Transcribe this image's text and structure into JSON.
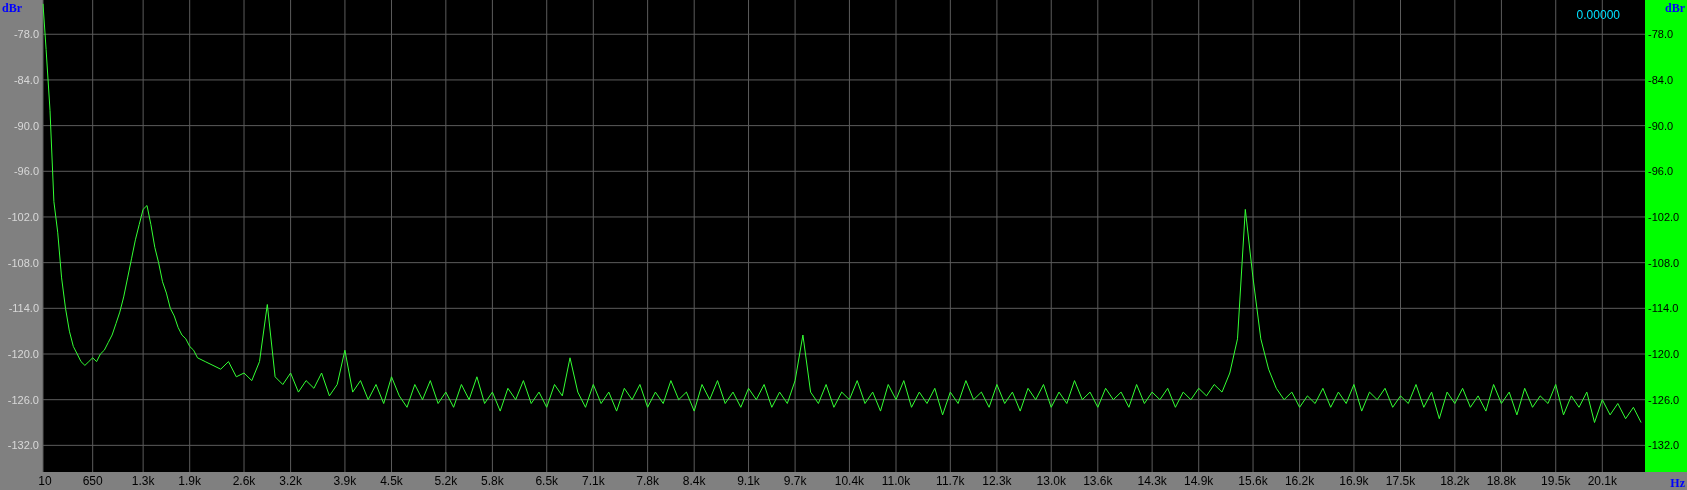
{
  "spectrum": {
    "y_unit": "dBr",
    "readout": "0.00000",
    "x_unit": "Hz",
    "right_axis": {
      "unit": "dBr",
      "labels": [
        "-78.0",
        "-84.0",
        "-90.0",
        "-96.0",
        "-102.0",
        "-108.0",
        "-114.0",
        "-120.0",
        "-126.0",
        "-132.0"
      ]
    },
    "chart_data": {
      "type": "line",
      "xlim": [
        10,
        20650
      ],
      "ylim": [
        -135.5,
        -73.5
      ],
      "yticks": [
        {
          "value": -78,
          "label": "-78.0"
        },
        {
          "value": -84,
          "label": "-84.0"
        },
        {
          "value": -90,
          "label": "-90.0"
        },
        {
          "value": -96,
          "label": "-96.0"
        },
        {
          "value": -102,
          "label": "-102.0"
        },
        {
          "value": -108,
          "label": "-108.0"
        },
        {
          "value": -114,
          "label": "-114.0"
        },
        {
          "value": -120,
          "label": "-120.0"
        },
        {
          "value": -126,
          "label": "-126.0"
        },
        {
          "value": -132,
          "label": "-132.0"
        }
      ],
      "grid": true,
      "xticks": [
        {
          "value": 10,
          "label": "10"
        },
        {
          "value": 650,
          "label": "650"
        },
        {
          "value": 1300,
          "label": "1.3k"
        },
        {
          "value": 1900,
          "label": "1.9k"
        },
        {
          "value": 2600,
          "label": "2.6k"
        },
        {
          "value": 3200,
          "label": "3.2k"
        },
        {
          "value": 3900,
          "label": "3.9k"
        },
        {
          "value": 4500,
          "label": "4.5k"
        },
        {
          "value": 5200,
          "label": "5.2k"
        },
        {
          "value": 5800,
          "label": "5.8k"
        },
        {
          "value": 6500,
          "label": "6.5k"
        },
        {
          "value": 7100,
          "label": "7.1k"
        },
        {
          "value": 7800,
          "label": "7.8k"
        },
        {
          "value": 8400,
          "label": "8.4k"
        },
        {
          "value": 9100,
          "label": "9.1k"
        },
        {
          "value": 9700,
          "label": "9.7k"
        },
        {
          "value": 10400,
          "label": "10.4k"
        },
        {
          "value": 11000,
          "label": "11.0k"
        },
        {
          "value": 11700,
          "label": "11.7k"
        },
        {
          "value": 12300,
          "label": "12.3k"
        },
        {
          "value": 13000,
          "label": "13.0k"
        },
        {
          "value": 13600,
          "label": "13.6k"
        },
        {
          "value": 14300,
          "label": "14.3k"
        },
        {
          "value": 14900,
          "label": "14.9k"
        },
        {
          "value": 15600,
          "label": "15.6k"
        },
        {
          "value": 16200,
          "label": "16.2k"
        },
        {
          "value": 16900,
          "label": "16.9k"
        },
        {
          "value": 17500,
          "label": "17.5k"
        },
        {
          "value": 18200,
          "label": "18.2k"
        },
        {
          "value": 18800,
          "label": "18.8k"
        },
        {
          "value": 19500,
          "label": "19.5k"
        },
        {
          "value": 20100,
          "label": "20.1k"
        }
      ],
      "x": [
        10,
        50,
        100,
        150,
        200,
        250,
        300,
        350,
        400,
        450,
        500,
        550,
        600,
        650,
        700,
        750,
        800,
        850,
        900,
        950,
        1000,
        1050,
        1100,
        1150,
        1200,
        1250,
        1300,
        1350,
        1400,
        1450,
        1500,
        1550,
        1600,
        1650,
        1700,
        1750,
        1800,
        1850,
        1900,
        1950,
        2000,
        2100,
        2200,
        2300,
        2400,
        2500,
        2600,
        2700,
        2800,
        2900,
        3000,
        3100,
        3200,
        3300,
        3400,
        3500,
        3600,
        3700,
        3800,
        3900,
        4000,
        4100,
        4200,
        4300,
        4400,
        4500,
        4600,
        4700,
        4800,
        4900,
        5000,
        5100,
        5200,
        5300,
        5400,
        5500,
        5600,
        5700,
        5800,
        5900,
        6000,
        6100,
        6200,
        6300,
        6400,
        6500,
        6600,
        6700,
        6800,
        6900,
        7000,
        7100,
        7200,
        7300,
        7400,
        7500,
        7600,
        7700,
        7800,
        7900,
        8000,
        8100,
        8200,
        8300,
        8400,
        8500,
        8600,
        8700,
        8800,
        8900,
        9000,
        9100,
        9200,
        9300,
        9400,
        9500,
        9600,
        9700,
        9800,
        9900,
        10000,
        10100,
        10200,
        10300,
        10400,
        10500,
        10600,
        10700,
        10800,
        10900,
        11000,
        11100,
        11200,
        11300,
        11400,
        11500,
        11600,
        11700,
        11800,
        11900,
        12000,
        12100,
        12200,
        12300,
        12400,
        12500,
        12600,
        12700,
        12800,
        12900,
        13000,
        13100,
        13200,
        13300,
        13400,
        13500,
        13600,
        13700,
        13800,
        13900,
        14000,
        14100,
        14200,
        14300,
        14400,
        14500,
        14600,
        14700,
        14800,
        14900,
        15000,
        15100,
        15200,
        15300,
        15400,
        15500,
        15600,
        15700,
        15800,
        15900,
        16000,
        16100,
        16200,
        16300,
        16400,
        16500,
        16600,
        16700,
        16800,
        16900,
        17000,
        17100,
        17200,
        17300,
        17400,
        17500,
        17600,
        17700,
        17800,
        17900,
        18000,
        18100,
        18200,
        18300,
        18400,
        18500,
        18600,
        18700,
        18800,
        18900,
        19000,
        19100,
        19200,
        19300,
        19400,
        19500,
        19600,
        19700,
        19800,
        19900,
        20000,
        20100,
        20200,
        20300,
        20400,
        20500,
        20600
      ],
      "series": [
        {
          "color": "#33ff33",
          "values": [
            -74,
            -80,
            -88,
            -100,
            -104,
            -110,
            -114,
            -117,
            -119,
            -120,
            -121,
            -121.5,
            -121,
            -120.5,
            -121,
            -120,
            -119.5,
            -118.5,
            -117.5,
            -116,
            -114.5,
            -112.5,
            -110,
            -107.5,
            -105,
            -103,
            -101,
            -100.5,
            -103,
            -106,
            -108,
            -110.5,
            -112,
            -114,
            -115,
            -116.5,
            -117.5,
            -118,
            -119,
            -119.5,
            -120.5,
            -121,
            -121.5,
            -122,
            -121,
            -123,
            -122.5,
            -123.5,
            -121,
            -113.5,
            -123,
            -124,
            -122.5,
            -125,
            -123.5,
            -124.5,
            -122.5,
            -125.5,
            -124,
            -119.5,
            -125,
            -123.5,
            -126,
            -124,
            -126.5,
            -123,
            -125.5,
            -127,
            -124,
            -126,
            -123.5,
            -126.5,
            -125,
            -127,
            -124,
            -126,
            -123,
            -126.5,
            -125,
            -127.5,
            -124.5,
            -126,
            -123.5,
            -126.5,
            -125,
            -127,
            -124,
            -125.5,
            -120.5,
            -125,
            -127,
            -124,
            -126.5,
            -125,
            -127.5,
            -124.5,
            -126,
            -124,
            -127,
            -125,
            -126.5,
            -123.5,
            -126,
            -125,
            -127.5,
            -124,
            -126,
            -123.5,
            -126.5,
            -125,
            -127,
            -124.5,
            -126,
            -124,
            -127,
            -125,
            -126.5,
            -123.5,
            -117.5,
            -125,
            -126.5,
            -124,
            -127,
            -125,
            -126,
            -123.5,
            -126.5,
            -125,
            -127.5,
            -124,
            -126,
            -123.5,
            -127,
            -125,
            -126.5,
            -124.5,
            -128,
            -125,
            -126.5,
            -123.5,
            -126,
            -125,
            -127,
            -124,
            -126.5,
            -125,
            -127.5,
            -124.5,
            -126,
            -124,
            -127,
            -125,
            -126.5,
            -123.5,
            -126,
            -125,
            -127,
            -124.5,
            -126,
            -125,
            -127,
            -124,
            -126.5,
            -125,
            -126,
            -124.5,
            -127,
            -125,
            -126,
            -124.5,
            -125.5,
            -124,
            -125,
            -122.5,
            -118,
            -101,
            -110,
            -118,
            -122,
            -124.5,
            -126,
            -125,
            -127,
            -125.5,
            -126.5,
            -124.5,
            -127,
            -125,
            -126.5,
            -124,
            -127.5,
            -125,
            -126,
            -124.5,
            -127,
            -125.5,
            -126.5,
            -124,
            -127,
            -125,
            -128.5,
            -125,
            -126.5,
            -124.5,
            -127,
            -125.5,
            -127.5,
            -124,
            -126.5,
            -125,
            -128,
            -124.5,
            -127,
            -125.5,
            -126.5,
            -124,
            -128,
            -125.5,
            -127,
            -125,
            -129,
            -126,
            -128,
            -126.5,
            -128.5,
            -127,
            -129
          ]
        }
      ]
    }
  }
}
